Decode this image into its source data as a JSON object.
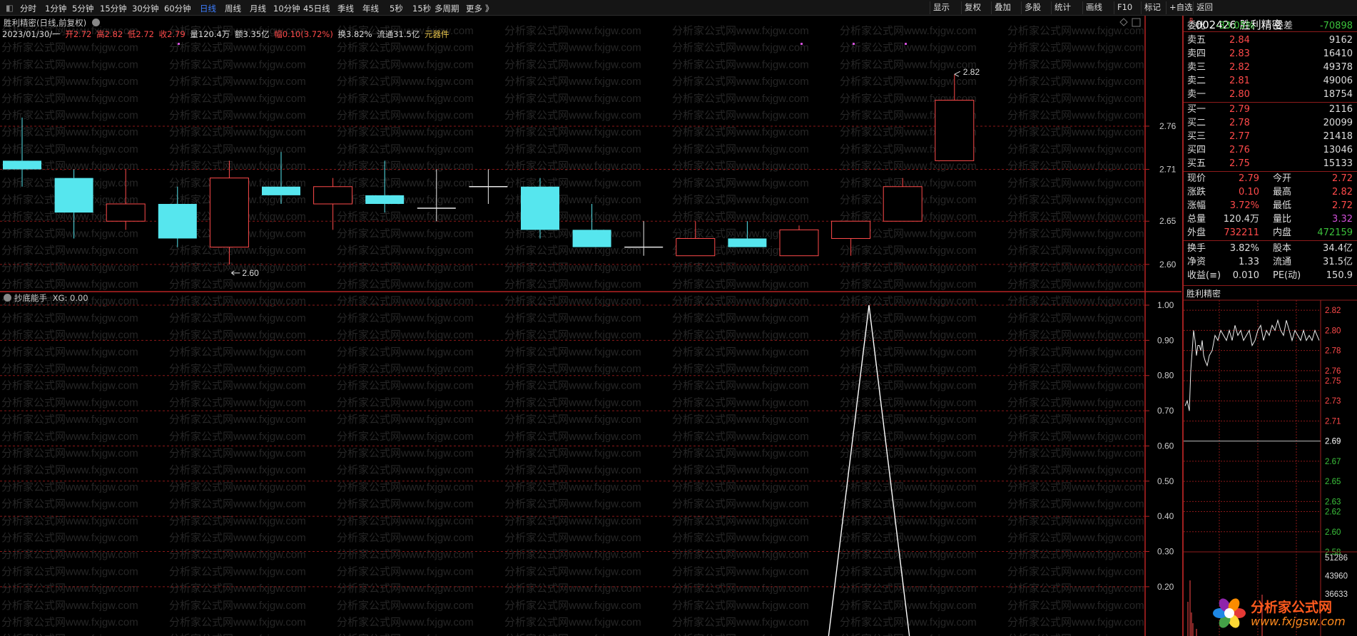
{
  "toolbar": {
    "periods": [
      "分时",
      "1分钟",
      "5分钟",
      "15分钟",
      "30分钟",
      "60分钟",
      "日线",
      "周线",
      "月线",
      "10分钟",
      "45日线",
      "季线",
      "年线",
      "5秒",
      "15秒",
      "多周期",
      "更多"
    ],
    "active_period": "日线",
    "more_suffix": "》",
    "right_buttons": [
      "显示",
      "复权",
      "叠加",
      "多股",
      "统计",
      "画线",
      "F10",
      "标记",
      "+自选",
      "返回"
    ]
  },
  "chart": {
    "title": "胜利精密(日线,前复权)",
    "info": {
      "date": "2023/01/30/一",
      "open": "开2.72",
      "high": "高2.82",
      "low": "低2.72",
      "close": "收2.79",
      "volume": "量120.4万",
      "amount": "额3.35亿",
      "amplitude": "幅0.10(3.72%)",
      "turnover": "换3.82%",
      "float_cap": "流通31.5亿",
      "sector": "元器件"
    },
    "labels": {
      "high": "2.82",
      "low": "2.60"
    }
  },
  "indicator": {
    "name": "抄底能手",
    "value": "XG: 0.00"
  },
  "chart_data": [
    {
      "type": "candlestick",
      "title": "胜利精密(日线,前复权)",
      "y_ticks": [
        2.6,
        2.65,
        2.71,
        2.76
      ],
      "ylim": [
        2.585,
        2.84
      ],
      "candles": [
        {
          "open": 2.72,
          "high": 2.77,
          "low": 2.69,
          "close": 2.71
        },
        {
          "open": 2.7,
          "high": 2.71,
          "low": 2.63,
          "close": 2.66
        },
        {
          "open": 2.65,
          "high": 2.71,
          "low": 2.64,
          "close": 2.67
        },
        {
          "open": 2.67,
          "high": 2.69,
          "low": 2.62,
          "close": 2.63
        },
        {
          "open": 2.62,
          "high": 2.72,
          "low": 2.6,
          "close": 2.7
        },
        {
          "open": 2.69,
          "high": 2.73,
          "low": 2.67,
          "close": 2.68
        },
        {
          "open": 2.67,
          "high": 2.7,
          "low": 2.64,
          "close": 2.69
        },
        {
          "open": 2.68,
          "high": 2.72,
          "low": 2.66,
          "close": 2.67
        },
        {
          "open": 2.665,
          "high": 2.71,
          "low": 2.65,
          "close": 2.665
        },
        {
          "open": 2.69,
          "high": 2.71,
          "low": 2.67,
          "close": 2.69
        },
        {
          "open": 2.69,
          "high": 2.7,
          "low": 2.63,
          "close": 2.64
        },
        {
          "open": 2.64,
          "high": 2.67,
          "low": 2.62,
          "close": 2.62
        },
        {
          "open": 2.62,
          "high": 2.65,
          "low": 2.61,
          "close": 2.62
        },
        {
          "open": 2.61,
          "high": 2.65,
          "low": 2.61,
          "close": 2.63
        },
        {
          "open": 2.63,
          "high": 2.65,
          "low": 2.62,
          "close": 2.62
        },
        {
          "open": 2.61,
          "high": 2.645,
          "low": 2.61,
          "close": 2.64
        },
        {
          "open": 2.63,
          "high": 2.65,
          "low": 2.61,
          "close": 2.65
        },
        {
          "open": 2.65,
          "high": 2.7,
          "low": 2.65,
          "close": 2.69
        },
        {
          "open": 2.72,
          "high": 2.82,
          "low": 2.72,
          "close": 2.79
        }
      ]
    },
    {
      "type": "line",
      "title": "抄底能手",
      "y_ticks": [
        0.2,
        0.3,
        0.4,
        0.5,
        0.6,
        0.7,
        0.8,
        0.9,
        1.0
      ],
      "ylim": [
        0.06,
        1.0
      ],
      "series": [
        {
          "name": "XG",
          "points": [
            [
              15.57,
              0.06
            ],
            [
              16.35,
              1.0
            ],
            [
              17.13,
              0.06
            ]
          ]
        }
      ]
    },
    {
      "type": "line",
      "title": "胜利精密",
      "y_ticks": [
        2.58,
        2.6,
        2.62,
        2.63,
        2.65,
        2.67,
        2.69,
        2.71,
        2.73,
        2.75,
        2.76,
        2.78,
        2.8,
        2.82
      ],
      "ylim": [
        2.58,
        2.83
      ],
      "reference": 2.69,
      "volume_ticks": [
        "51286",
        "43960",
        "36633"
      ]
    }
  ],
  "quote": {
    "code": "002426",
    "name": "胜利精密",
    "flag": "R",
    "weibi_label": "委比",
    "weibi": "-33.05%",
    "weicha_label": "委差",
    "weicha": "-70898",
    "sell": [
      {
        "label": "卖五",
        "price": "2.84",
        "vol": "9162"
      },
      {
        "label": "卖四",
        "price": "2.83",
        "vol": "16410"
      },
      {
        "label": "卖三",
        "price": "2.82",
        "vol": "49378"
      },
      {
        "label": "卖二",
        "price": "2.81",
        "vol": "49006"
      },
      {
        "label": "卖一",
        "price": "2.80",
        "vol": "18754"
      }
    ],
    "buy": [
      {
        "label": "买一",
        "price": "2.79",
        "vol": "2116"
      },
      {
        "label": "买二",
        "price": "2.78",
        "vol": "20099"
      },
      {
        "label": "买三",
        "price": "2.77",
        "vol": "21418"
      },
      {
        "label": "买四",
        "price": "2.76",
        "vol": "13046"
      },
      {
        "label": "买五",
        "price": "2.75",
        "vol": "15133"
      }
    ],
    "stats": [
      {
        "l1": "现价",
        "v1": "2.79",
        "l2": "今开",
        "v2": "2.72"
      },
      {
        "l1": "涨跌",
        "v1": "0.10",
        "l2": "最高",
        "v2": "2.82"
      },
      {
        "l1": "涨幅",
        "v1": "3.72%",
        "l2": "最低",
        "v2": "2.72"
      },
      {
        "l1": "总量",
        "v1": "120.4万",
        "l2": "量比",
        "v2": "3.32"
      },
      {
        "l1": "外盘",
        "v1": "732211",
        "l2": "内盘",
        "v2": "472159"
      }
    ],
    "stats2": [
      {
        "l1": "换手",
        "v1": "3.82%",
        "l2": "股本",
        "v2": "34.4亿"
      },
      {
        "l1": "净资",
        "v1": "1.33",
        "l2": "流通",
        "v2": "31.5亿"
      },
      {
        "l1": "收益(≡)",
        "v1": "0.010",
        "l2": "PE(动)",
        "v2": "150.9"
      }
    ],
    "mini_title": "胜利精密"
  },
  "watermark": "分析家公式网www.fxjgw.com",
  "logo": {
    "title": "分析家公式网",
    "url": "www.fxjgsw.com"
  },
  "colors": {
    "up": "#ff4a4a",
    "down": "#56e6ee",
    "grid": "#8a1818",
    "accent": "#3d7eff"
  }
}
